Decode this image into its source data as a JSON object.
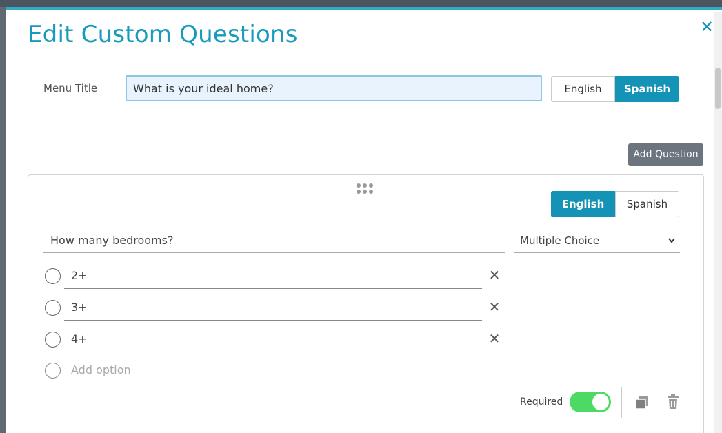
{
  "dialog": {
    "title": "Edit Custom Questions",
    "close_glyph": "✕"
  },
  "menu": {
    "label": "Menu Title",
    "value": "What is your ideal home?",
    "languages": [
      "English",
      "Spanish"
    ],
    "active_language": "Spanish"
  },
  "add_question_label": "Add Question",
  "question": {
    "languages": [
      "English",
      "Spanish"
    ],
    "active_language": "English",
    "text": "How many bedrooms?",
    "type": "Multiple Choice",
    "options": [
      "2+",
      "3+",
      "4+"
    ],
    "add_option_placeholder": "Add option",
    "required_label": "Required",
    "required": true
  },
  "colors": {
    "accent": "#1593b6",
    "toggle_on": "#4cd964",
    "add_question_bg": "#6c757d"
  },
  "icons": [
    "close-icon",
    "drag-handle-icon",
    "chevron-down-icon",
    "remove-option-icon",
    "copy-icon",
    "trash-icon"
  ]
}
